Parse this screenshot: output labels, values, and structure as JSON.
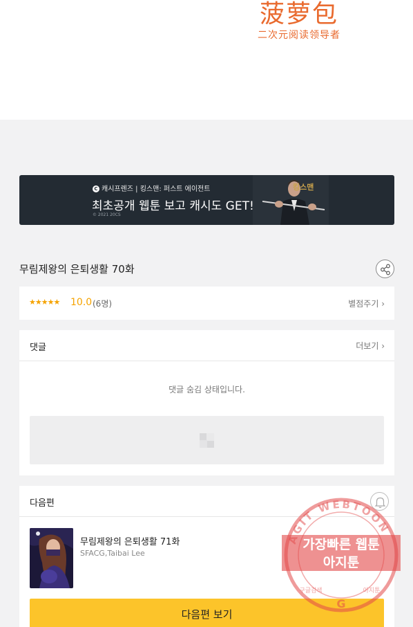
{
  "logo": {
    "main": "菠萝包",
    "sub": "二次元阅读领导者"
  },
  "banner": {
    "brand": "캐시프렌즈 | 킹스맨: 퍼스트 에이전트",
    "headline": "최초공개 웹툰 보고 캐시도 GET!",
    "copyright": "© 2021 20CS",
    "badge": "킹스맨",
    "colors": {
      "background": "#232b33",
      "badge": "#c9a24b"
    }
  },
  "episode": {
    "title": "무림제왕의 은퇴생활 70화",
    "share_icon": "share-icon"
  },
  "rating": {
    "stars": "★★★★★",
    "score": "10.0",
    "votes": "(6명)",
    "rate_label": "별점주기 ›",
    "colors": {
      "accent": "#f5a300"
    }
  },
  "comments": {
    "header": "댓글",
    "more": "더보기 ›",
    "hidden_message": "댓글 숨김 상태입니다."
  },
  "next": {
    "header": "다음편",
    "bell_icon": "bell-icon",
    "title": "무림제왕의 은퇴생활 71화",
    "author": "SFACG,Taibai Lee",
    "button_label": "다음편 보기",
    "colors": {
      "button": "#fcc42a"
    }
  },
  "watermark": {
    "line1": "가장빠른 웹툰",
    "line2": "아지툰",
    "ring": "AGIT WEBTOON",
    "bottom_left": "구글검색",
    "bottom_right": "아지툰",
    "mark": "G"
  }
}
